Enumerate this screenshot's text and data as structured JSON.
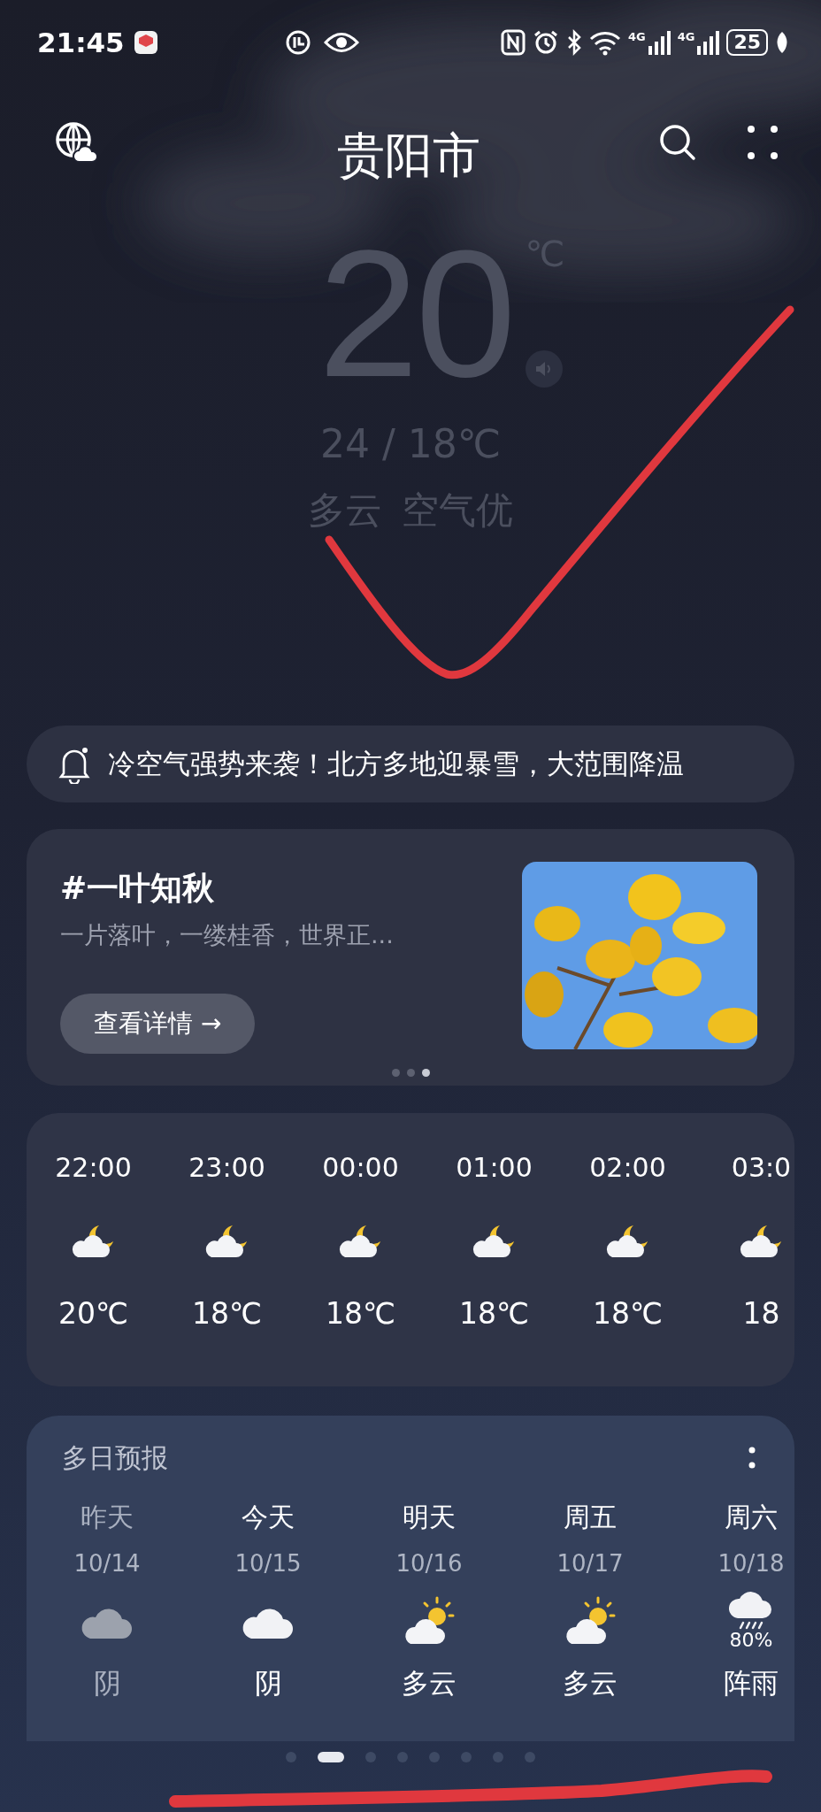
{
  "status_bar": {
    "time": "21:45",
    "network": [
      "4G",
      "4G"
    ],
    "battery": "25"
  },
  "header": {
    "city": "贵阳市"
  },
  "current": {
    "temperature": "20",
    "unit": "℃",
    "range": "24 / 18℃",
    "condition": "多云",
    "air": "空气优"
  },
  "alert": {
    "text": "冷空气强势来袭！北方多地迎暴雪，大范围降温"
  },
  "topic": {
    "title": "#一叶知秋",
    "subtitle": "一片落叶，一缕桂香，世界正...",
    "button": "查看详情 →",
    "pages": [
      {
        "selected": false
      },
      {
        "selected": false
      },
      {
        "selected": true
      }
    ]
  },
  "hourly": [
    {
      "time": "22:00",
      "kind": "moon-cloud",
      "temp": "20℃"
    },
    {
      "time": "23:00",
      "kind": "moon-cloud",
      "temp": "18℃"
    },
    {
      "time": "00:00",
      "kind": "moon-cloud",
      "temp": "18℃"
    },
    {
      "time": "01:00",
      "kind": "moon-cloud",
      "temp": "18℃"
    },
    {
      "time": "02:00",
      "kind": "moon-cloud",
      "temp": "18℃"
    },
    {
      "time": "03:0",
      "kind": "moon-cloud",
      "temp": "18"
    }
  ],
  "daily": {
    "title": "多日预报",
    "days": [
      {
        "day": "昨天",
        "date": "10/14",
        "kind": "overcast",
        "condition": "阴",
        "past": true
      },
      {
        "day": "今天",
        "date": "10/15",
        "kind": "overcast",
        "condition": "阴",
        "past": false
      },
      {
        "day": "明天",
        "date": "10/16",
        "kind": "sun-cloud",
        "condition": "多云",
        "past": false
      },
      {
        "day": "周五",
        "date": "10/17",
        "kind": "sun-cloud",
        "condition": "多云",
        "past": false
      },
      {
        "day": "周六",
        "date": "10/18",
        "kind": "shower",
        "precip": "80%",
        "condition": "阵雨",
        "past": false
      }
    ]
  },
  "page_indicator": [
    {
      "selected": false
    },
    {
      "selected": true
    },
    {
      "selected": false
    },
    {
      "selected": false
    },
    {
      "selected": false
    },
    {
      "selected": false
    },
    {
      "selected": false
    },
    {
      "selected": false
    }
  ]
}
